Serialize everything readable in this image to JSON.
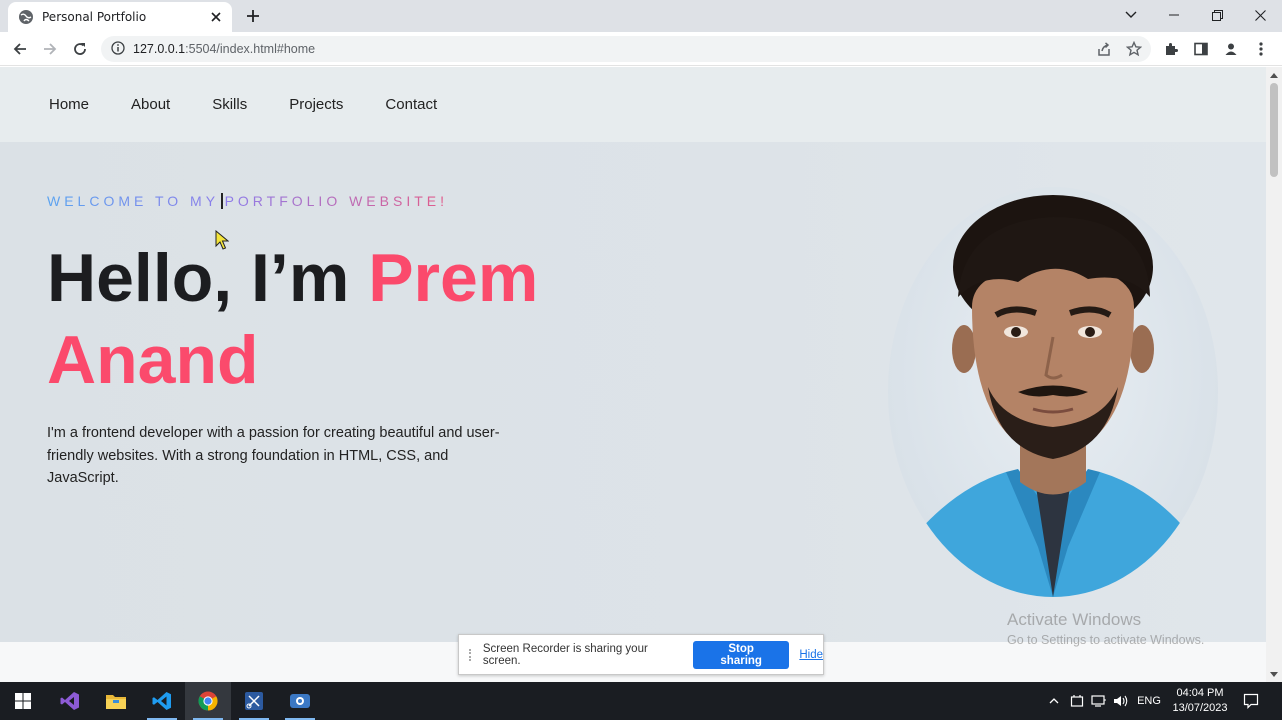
{
  "browser": {
    "tab_title": "Personal Portfolio",
    "url_host": "127.0.0.1",
    "url_rest": ":5504/index.html#home"
  },
  "nav": {
    "items": [
      "Home",
      "About",
      "Skills",
      "Projects",
      "Contact"
    ]
  },
  "hero": {
    "welcome_typed": "WELCOME TO MY",
    "welcome_rest": "PORTFOLIO WEBSITE!",
    "greeting": "Hello, I’m ",
    "name_first": "Prem",
    "name_last": "Anand",
    "intro": "I'm a frontend developer with a passion for creating beautiful and user-friendly websites. With a strong foundation in HTML, CSS, and JavaScript."
  },
  "watermark": {
    "line1": "Activate Windows",
    "line2": "Go to Settings to activate Windows."
  },
  "share_bar": {
    "message": "Screen Recorder is sharing your screen.",
    "stop_label": "Stop sharing",
    "hide_label": "Hide"
  },
  "taskbar": {
    "language": "ENG",
    "time": "04:04 PM",
    "date": "13/07/2023",
    "apps": [
      "start-icon",
      "visual-studio-icon",
      "file-explorer-icon",
      "vscode-icon",
      "chrome-icon",
      "snipping-tool-icon",
      "screen-recorder-icon"
    ]
  },
  "colors": {
    "accent_name": "#fb4a6c",
    "stop_button": "#1a73e8",
    "hero_bg": "#dde3e8"
  }
}
